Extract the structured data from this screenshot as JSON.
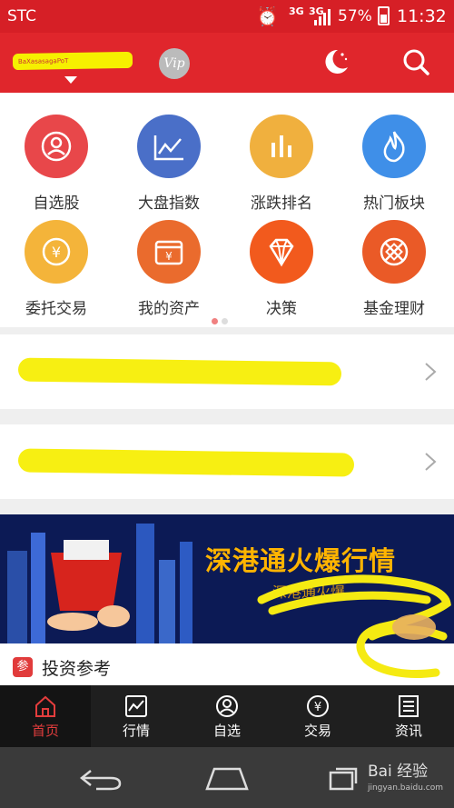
{
  "status_bar": {
    "carrier": "STC",
    "net_primary": "3G",
    "net_secondary": "3G",
    "battery": "57%",
    "battery_level": 0.57,
    "time": "11:32"
  },
  "header": {
    "account_name": "BaXasasagaPoT",
    "vip_label": "Vip"
  },
  "grid": [
    {
      "label": "自选股",
      "icon": "user-circle-icon",
      "color": "#e8474a"
    },
    {
      "label": "大盘指数",
      "icon": "line-chart-icon",
      "color": "#4a6fc8"
    },
    {
      "label": "涨跌排名",
      "icon": "bar-chart-icon",
      "color": "#f0b03e"
    },
    {
      "label": "热门板块",
      "icon": "flame-icon",
      "color": "#3f8fe8"
    },
    {
      "label": "委托交易",
      "icon": "yen-coin-icon",
      "color": "#f4b43a"
    },
    {
      "label": "我的资产",
      "icon": "wallet-icon",
      "color": "#ea6b2d"
    },
    {
      "label": "决策",
      "icon": "diamond-icon",
      "color": "#f25a1d"
    },
    {
      "label": "基金理财",
      "icon": "fund-icon",
      "color": "#ea5a27"
    }
  ],
  "banner": {
    "title": "深港通火爆行情",
    "subtitle": "深港通火爆..."
  },
  "section": {
    "badge": "参",
    "title": "投资参考"
  },
  "tabs": [
    {
      "label": "首页",
      "icon": "home-icon",
      "active": true
    },
    {
      "label": "行情",
      "icon": "chart-icon",
      "active": false
    },
    {
      "label": "自选",
      "icon": "user-icon",
      "active": false
    },
    {
      "label": "交易",
      "icon": "yen-icon",
      "active": false
    },
    {
      "label": "资讯",
      "icon": "news-icon",
      "active": false
    }
  ],
  "watermark": {
    "brand": "Bai 经验",
    "url": "jingyan.baidu.com"
  },
  "colors": {
    "brand_red": "#e0262c",
    "active_tab": "#e33d3d",
    "highlight": "#f7ef12"
  }
}
